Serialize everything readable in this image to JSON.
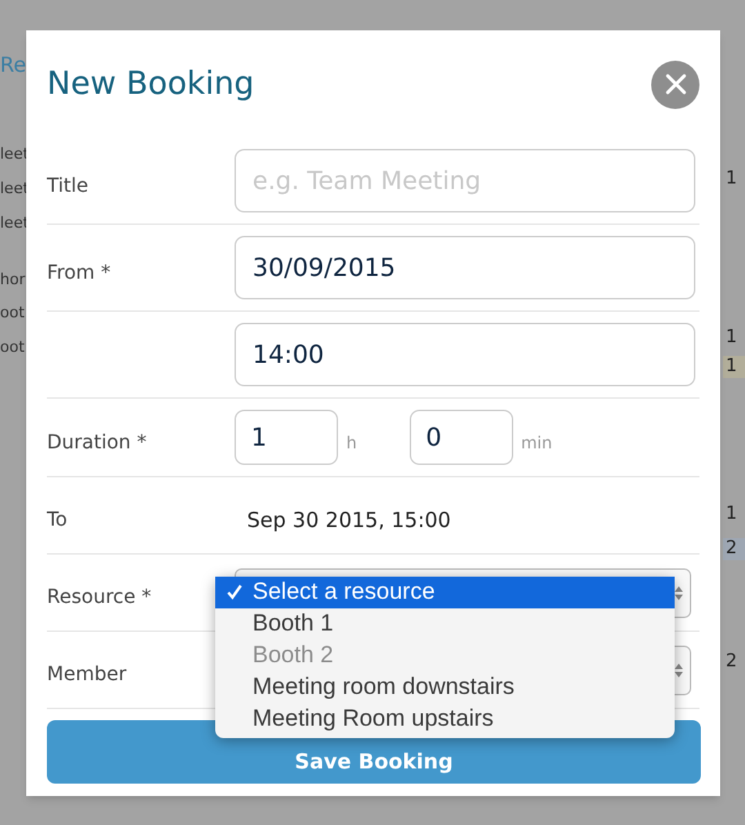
{
  "background": {
    "link": "Re",
    "left_items": [
      "leet",
      "leet",
      "leet",
      "hor",
      "oot",
      "oot"
    ],
    "right_items": [
      {
        "text": "1",
        "kind": "plain"
      },
      {
        "text": "1",
        "kind": "plain"
      },
      {
        "text": "1",
        "kind": "tinted"
      },
      {
        "text": "1",
        "kind": "plain"
      },
      {
        "text": "2",
        "kind": "shaded"
      },
      {
        "text": "2",
        "kind": "plain"
      }
    ]
  },
  "dialog": {
    "title": "New Booking",
    "fields": [
      {
        "kind": "text",
        "label": "Title",
        "placeholder": "e.g. Team Meeting"
      },
      {
        "kind": "text",
        "label": "From *",
        "value": "30/09/2015"
      },
      {
        "kind": "text",
        "value": "14:00"
      },
      {
        "kind": "duration",
        "label": "Duration *",
        "parts": [
          {
            "value": "1",
            "unit": "h"
          },
          {
            "value": "0",
            "unit": "min"
          }
        ]
      },
      {
        "kind": "static",
        "label": "To",
        "value": "Sep 30 2015, 15:00"
      },
      {
        "kind": "select",
        "label": "Resource *",
        "expanded": true,
        "options": [
          {
            "label": "Select a resource",
            "selected": true,
            "disabled": false
          },
          {
            "label": "Booth 1",
            "selected": false,
            "disabled": false
          },
          {
            "label": "Booth 2",
            "selected": false,
            "disabled": true
          },
          {
            "label": "Meeting room downstairs",
            "selected": false,
            "disabled": false
          },
          {
            "label": "Meeting Room upstairs",
            "selected": false,
            "disabled": false
          }
        ]
      },
      {
        "kind": "select",
        "label": "Member",
        "expanded": false
      }
    ],
    "save_button": "Save Booking"
  }
}
